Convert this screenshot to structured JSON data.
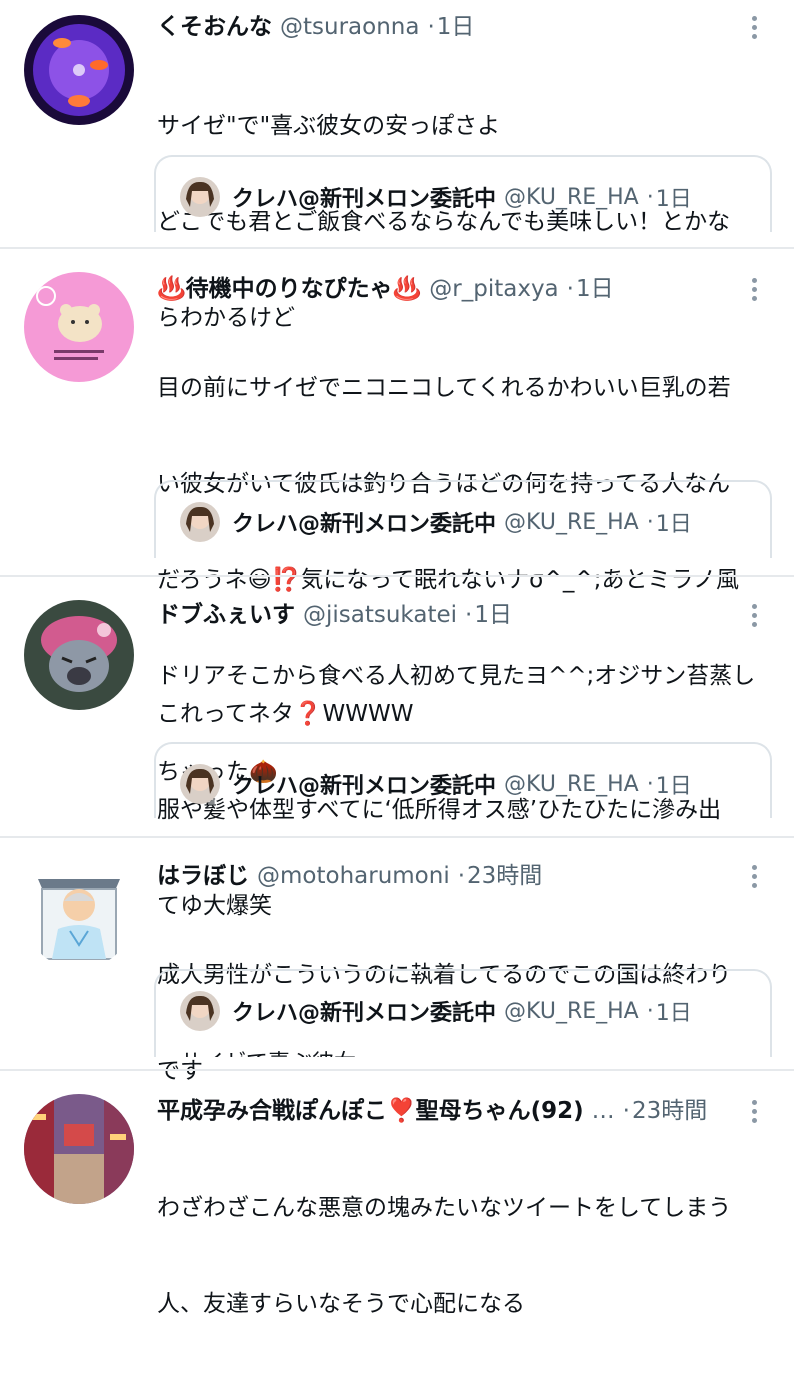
{
  "tweets": [
    {
      "name": "くそおんな",
      "handle": "@tsuraonna",
      "time": "1日",
      "avatar_icon": "goldfish-bowl-avatar",
      "lines": [
        "サイゼ\"で\"喜ぶ彼女の安っぽさよ",
        "どこでも君とご飯食べるならなんでも美味しい！とかな",
        "らわかるけど"
      ],
      "quote": {
        "name": "クレハ@新刊メロン委託中",
        "handle": "@KU_RE_HA",
        "time": "1日"
      }
    },
    {
      "name": "♨️待機中のりなぴたゃ♨️",
      "handle": "@r_pitaxya",
      "time": "1日",
      "avatar_icon": "bear-sticker-avatar",
      "lines": [
        "目の前にサイゼでニコニコしてくれるかわいい巨乳の若",
        "い彼女がいて彼氏は釣り合うほどの何を持ってる人なん",
        "だろうネ😃⁉️気になって眠れないナσ^_^;あとミラノ風",
        "ドリアそこから食べる人初めて見たヨ^^;オジサン苔蒸し",
        "ちゃった🌰"
      ],
      "quote": {
        "name": "クレハ@新刊メロン委託中",
        "handle": "@KU_RE_HA",
        "time": "1日"
      }
    },
    {
      "name": "ドブふぇいす",
      "handle": "@jisatsukatei",
      "time": "1日",
      "avatar_icon": "crying-character-avatar",
      "lines": [
        "これってネタ❓WWWW",
        "服や髪や体型すべてに‘低所得オス感’ひたひたに滲み出",
        "てゆ大爆笑"
      ],
      "quote": {
        "name": "クレハ@新刊メロン委託中",
        "handle": "@KU_RE_HA",
        "time": "1日"
      }
    },
    {
      "name": "はラぼじ",
      "handle": "@motoharumoni",
      "time": "23時間",
      "avatar_icon": "hospital-patient-avatar",
      "lines": [
        "成人男性がこういうのに執着してるのでこの国は終わり",
        "です"
      ],
      "quote": {
        "name": "クレハ@新刊メロン委託中",
        "handle": "@KU_RE_HA",
        "time": "1日",
        "peek": "サイゼで喜ぶ彼女"
      }
    },
    {
      "name": "平成孕み合戦ぽんぽこ❣️聖母ちゃん(92)",
      "handle": "…",
      "time": "23時間",
      "avatar_icon": "city-street-avatar",
      "lines": [
        "わざわざこんな悪意の塊みたいなツイートをしてしまう",
        "人、友達すらいなそうで心配になる"
      ]
    }
  ]
}
